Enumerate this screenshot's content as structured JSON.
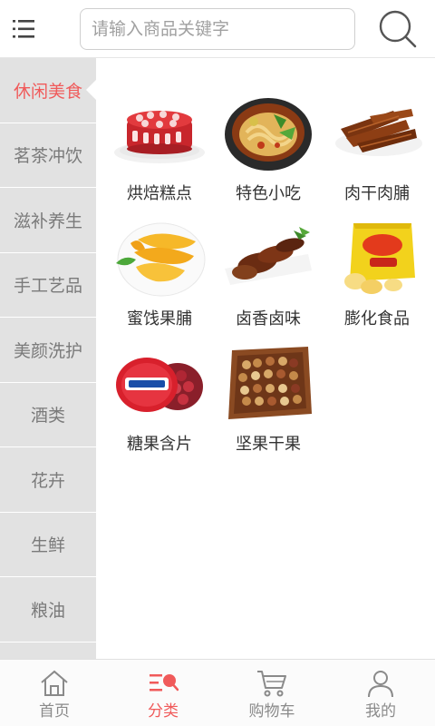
{
  "header": {
    "search_placeholder": "请输入商品关键字"
  },
  "sidebar": {
    "items": [
      {
        "label": "休闲美食",
        "active": true
      },
      {
        "label": "茗茶冲饮"
      },
      {
        "label": "滋补养生"
      },
      {
        "label": "手工艺品"
      },
      {
        "label": "美颜洗护"
      },
      {
        "label": "酒类"
      },
      {
        "label": "花卉"
      },
      {
        "label": "生鲜"
      },
      {
        "label": "粮油"
      }
    ]
  },
  "products": [
    {
      "label": "烘焙糕点",
      "icon": "cake-image"
    },
    {
      "label": "特色小吃",
      "icon": "noodle-bowl-image"
    },
    {
      "label": "肉干肉脯",
      "icon": "jerky-image"
    },
    {
      "label": "蜜饯果脯",
      "icon": "dried-mango-image"
    },
    {
      "label": "卤香卤味",
      "icon": "braised-duck-image"
    },
    {
      "label": "膨化食品",
      "icon": "snack-bag-image"
    },
    {
      "label": "糖果含片",
      "icon": "candy-tin-image"
    },
    {
      "label": "坚果干果",
      "icon": "nuts-box-image"
    }
  ],
  "bottom_nav": {
    "items": [
      {
        "label": "首页",
        "icon": "home-icon"
      },
      {
        "label": "分类",
        "icon": "category-icon",
        "active": true
      },
      {
        "label": "购物车",
        "icon": "cart-icon"
      },
      {
        "label": "我的",
        "icon": "user-icon"
      }
    ]
  },
  "colors": {
    "accent": "#f05a5a",
    "sidebar_bg": "#e2e2e2",
    "inactive_text": "#8a8a8a"
  }
}
